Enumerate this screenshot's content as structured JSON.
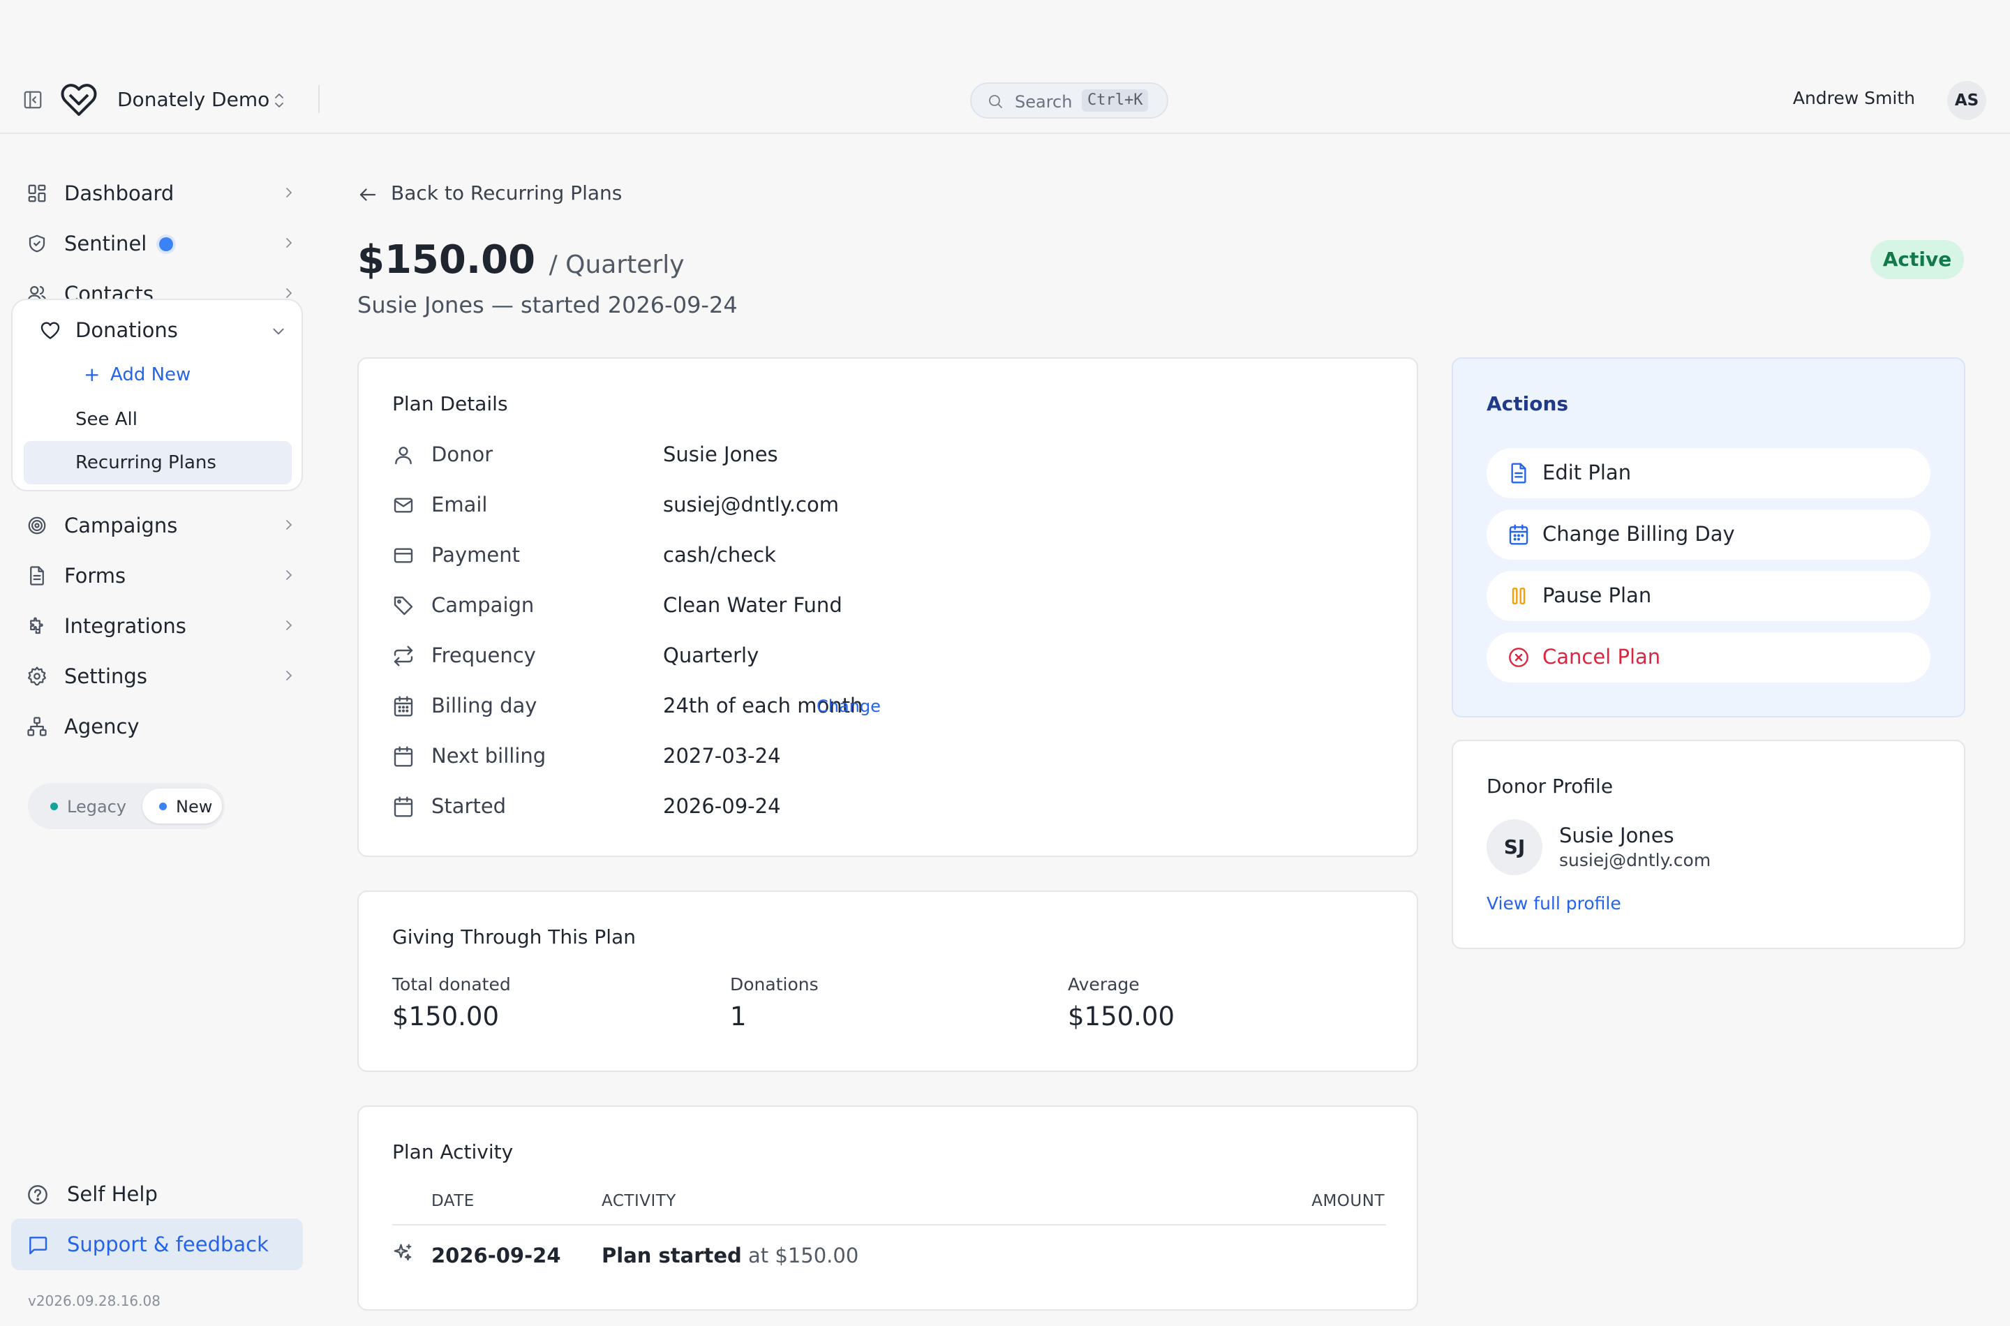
{
  "header": {
    "org_name": "Donately Demo",
    "search": {
      "label": "Search",
      "shortcut": "Ctrl+K"
    },
    "user": {
      "name": "Andrew Smith",
      "initials": "AS"
    }
  },
  "sidebar": {
    "items": [
      {
        "label": "Dashboard",
        "icon": "dashboard-icon"
      },
      {
        "label": "Sentinel",
        "icon": "shield-icon"
      },
      {
        "label": "Contacts",
        "icon": "users-icon"
      },
      {
        "label": "Donations",
        "icon": "heart-icon"
      },
      {
        "label": "Campaigns",
        "icon": "target-icon"
      },
      {
        "label": "Forms",
        "icon": "document-icon"
      },
      {
        "label": "Integrations",
        "icon": "puzzle-icon"
      },
      {
        "label": "Settings",
        "icon": "gear-icon"
      },
      {
        "label": "Agency",
        "icon": "network-icon"
      }
    ],
    "donations_sub": {
      "add_new": "Add New",
      "see_all": "See All",
      "recurring": "Recurring Plans"
    },
    "mode_toggle": {
      "legacy": "Legacy",
      "new": "New",
      "selected": "New"
    },
    "self_help": "Self Help",
    "support": "Support & feedback",
    "version": "v2026.09.28.16.08"
  },
  "main": {
    "back_label": "Back to Recurring Plans",
    "amount": "$150.00",
    "frequency_suffix": "/ Quarterly",
    "subtitle": "Susie Jones — started 2026-09-24",
    "status": "Active",
    "colors": {
      "status_bg": "#d6f5e4",
      "status_text": "#13794a",
      "accent": "#2563eb",
      "danger": "#dc2640",
      "pause": "#f59e0b"
    }
  },
  "plan_details": {
    "title": "Plan Details",
    "rows": [
      {
        "icon": "user-icon",
        "label": "Donor",
        "value": "Susie Jones"
      },
      {
        "icon": "mail-icon",
        "label": "Email",
        "value": "susiej@dntly.com"
      },
      {
        "icon": "credit-card-icon",
        "label": "Payment",
        "value": "cash/check"
      },
      {
        "icon": "tag-icon",
        "label": "Campaign",
        "value": "Clean Water Fund"
      },
      {
        "icon": "repeat-icon",
        "label": "Frequency",
        "value": "Quarterly"
      },
      {
        "icon": "calendar-grid-icon",
        "label": "Billing day",
        "value": "24th of each month",
        "link": "Change"
      },
      {
        "icon": "calendar-icon",
        "label": "Next billing",
        "value": "2027-03-24"
      },
      {
        "icon": "calendar-icon",
        "label": "Started",
        "value": "2026-09-24"
      }
    ]
  },
  "giving": {
    "title": "Giving Through This Plan",
    "stats": [
      {
        "label": "Total donated",
        "value": "$150.00"
      },
      {
        "label": "Donations",
        "value": "1"
      },
      {
        "label": "Average",
        "value": "$150.00"
      }
    ]
  },
  "activity": {
    "title": "Plan Activity",
    "columns": [
      "DATE",
      "ACTIVITY",
      "AMOUNT"
    ],
    "rows": [
      {
        "date": "2026-09-24",
        "activity": "Plan started",
        "suffix": "at $150.00",
        "amount": ""
      }
    ]
  },
  "actions": {
    "title": "Actions",
    "buttons": [
      {
        "label": "Edit Plan",
        "icon": "file-edit-icon"
      },
      {
        "label": "Change Billing Day",
        "icon": "calendar-icon"
      },
      {
        "label": "Pause Plan",
        "icon": "pause-icon"
      },
      {
        "label": "Cancel Plan",
        "icon": "x-circle-icon"
      }
    ]
  },
  "donor_profile": {
    "title": "Donor Profile",
    "initials": "SJ",
    "name": "Susie Jones",
    "email": "susiej@dntly.com",
    "link": "View full profile"
  }
}
